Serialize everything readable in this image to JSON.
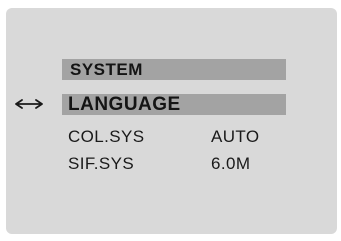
{
  "osd": {
    "title": "SYSTEM",
    "selected_item": "LANGUAGE",
    "selection_icon": "double-arrow-icon",
    "rows": [
      {
        "label": "COL.SYS",
        "value": "AUTO"
      },
      {
        "label": "SIF.SYS",
        "value": "6.0M"
      }
    ],
    "colors": {
      "background": "#d9d9d9",
      "highlight_bar": "#a3a3a3",
      "text": "#1a1a1a"
    }
  }
}
